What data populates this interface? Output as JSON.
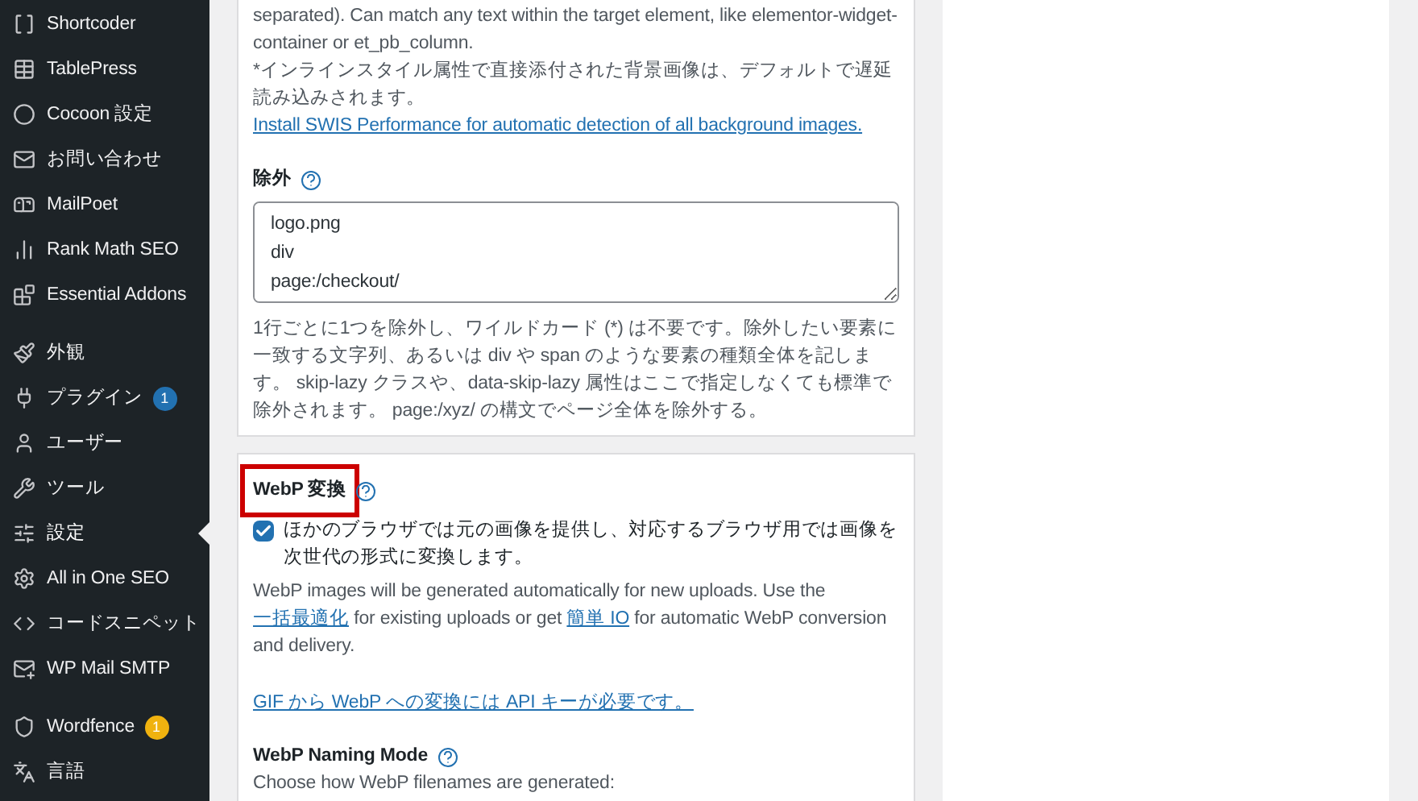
{
  "sidebar": {
    "groups": [
      [
        {
          "label": "Shortcoder",
          "selected": false
        },
        {
          "label": "TablePress",
          "selected": false
        },
        {
          "label": "Cocoon 設定",
          "selected": false
        },
        {
          "label": "お問い合わせ",
          "selected": false
        },
        {
          "label": "MailPoet",
          "selected": false
        },
        {
          "label": "Rank Math SEO",
          "selected": false
        },
        {
          "label": "Essential Addons",
          "selected": false
        }
      ],
      [
        {
          "label": "外観",
          "selected": false
        },
        {
          "label": "プラグイン",
          "selected": false,
          "badge": {
            "text": "1",
            "color": "#2271b1"
          }
        },
        {
          "label": "ユーザー",
          "selected": false
        },
        {
          "label": "ツール",
          "selected": false
        },
        {
          "label": "設定",
          "selected": true
        },
        {
          "label": "All in One SEO",
          "selected": false
        },
        {
          "label": "コードスニペット",
          "selected": false
        },
        {
          "label": "WP Mail SMTP",
          "selected": false
        }
      ],
      [
        {
          "label": "Wordfence",
          "selected": false,
          "badge": {
            "text": "1",
            "color": "#f0b20f"
          }
        },
        {
          "label": "言語",
          "selected": false
        }
      ]
    ]
  },
  "cards": [
    {
      "blocks": [
        {
          "kind": "text",
          "text": "separated). Can match any text within the target element, like elementor-widget-container or et_pb_column."
        },
        {
          "kind": "text",
          "text": "*インラインスタイル属性で直接添付された背景画像は、デフォルトで遅延読み込みされます。"
        },
        {
          "kind": "link",
          "text": "Install SWIS Performance for automatic detection of all background images."
        },
        {
          "kind": "label",
          "text": "除外",
          "help": true
        },
        {
          "kind": "textarea",
          "value": "logo.png\ndiv\npage:/checkout/"
        },
        {
          "kind": "text",
          "text": "1行ごとに1つを除外し、ワイルドカード (*) は不要です。除外したい要素に一致する文字列、あるいは div や span のような要素の種類全体を記します。 skip-lazy クラスや、data-skip-lazy 属性はここで指定しなくても標準で除外されます。 page:/xyz/ の構文でページ全体を除外する。"
        }
      ]
    },
    {
      "blocks": [
        {
          "kind": "label",
          "text": "WebP 変換",
          "help": true,
          "highlighted": true
        },
        {
          "kind": "checkbox",
          "checked": true,
          "text": "ほかのブラウザでは元の画像を提供し、対応するブラウザ用では画像を次世代の形式に変換します。"
        },
        {
          "kind": "mixed",
          "parts": [
            {
              "text": "WebP images will be generated automatically for new uploads. Use the "
            },
            {
              "link": "一括最適化"
            },
            {
              "text": " for existing uploads or get "
            },
            {
              "link": "簡単 IO"
            },
            {
              "text": " for automatic WebP conversion and delivery."
            }
          ]
        },
        {
          "kind": "link",
          "text": "GIF から WebP への変換には API キーが必要です。"
        },
        {
          "kind": "label",
          "text": "WebP Naming Mode",
          "help": true
        },
        {
          "kind": "text",
          "text": "Choose how WebP filenames are generated:"
        }
      ]
    }
  ]
}
